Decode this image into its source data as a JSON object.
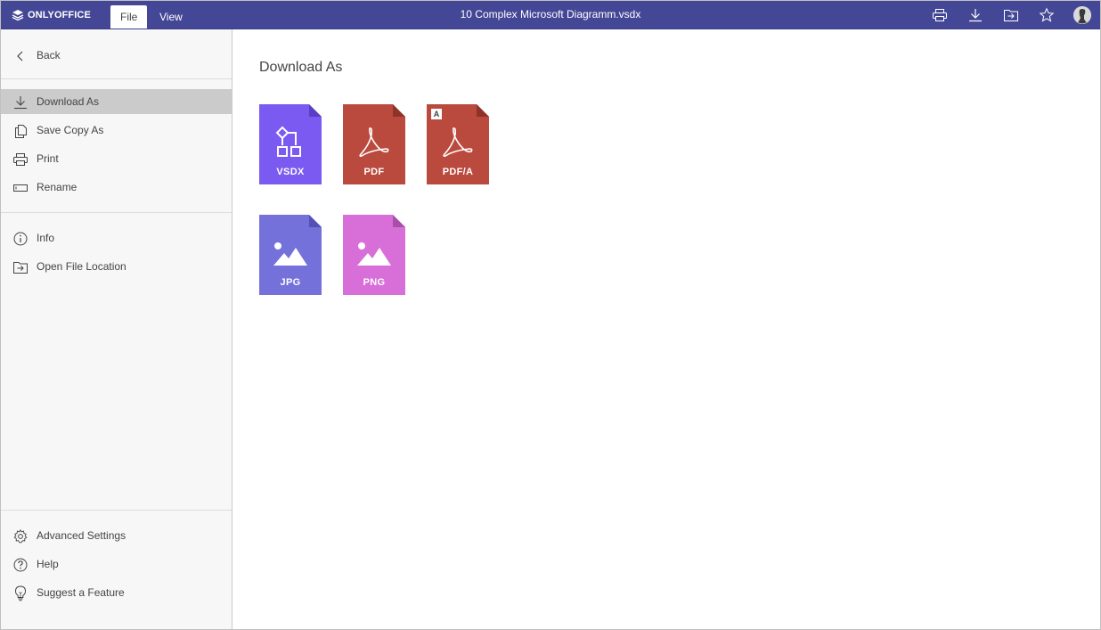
{
  "topbar": {
    "logo_text": "ONLYOFFICE",
    "tabs": [
      {
        "label": "File",
        "active": true
      },
      {
        "label": "View",
        "active": false
      }
    ],
    "document_title": "10 Complex Microsoft Diagramm.vsdx",
    "icons": [
      "print-icon",
      "download-icon",
      "open-location-icon",
      "favorite-star-icon",
      "user-avatar"
    ]
  },
  "sidebar": {
    "back_label": "Back",
    "group1": [
      {
        "label": "Download As",
        "icon": "download-icon",
        "active": true
      },
      {
        "label": "Save Copy As",
        "icon": "copy-icon",
        "active": false
      },
      {
        "label": "Print",
        "icon": "print-icon",
        "active": false
      },
      {
        "label": "Rename",
        "icon": "rename-icon",
        "active": false
      }
    ],
    "group2": [
      {
        "label": "Info",
        "icon": "info-icon"
      },
      {
        "label": "Open File Location",
        "icon": "folder-open-icon"
      }
    ],
    "group3": [
      {
        "label": "Advanced Settings",
        "icon": "gear-icon"
      },
      {
        "label": "Help",
        "icon": "help-icon"
      },
      {
        "label": "Suggest a Feature",
        "icon": "lightbulb-icon"
      }
    ]
  },
  "main": {
    "heading": "Download As",
    "formats": [
      {
        "label": "VSDX",
        "color": "#7a5af0",
        "icon": "diagram-icon"
      },
      {
        "label": "PDF",
        "color": "#bb4a3e",
        "icon": "acrobat-icon"
      },
      {
        "label": "PDF/A",
        "color": "#bb4a3e",
        "icon": "acrobat-icon",
        "badge": "A"
      },
      {
        "label": "JPG",
        "color": "#7471db",
        "icon": "image-icon"
      },
      {
        "label": "PNG",
        "color": "#d86ed8",
        "icon": "image-icon"
      }
    ]
  },
  "colors": {
    "topbar": "#444796",
    "sidebar_bg": "#f7f7f7",
    "active_item": "#cbcbcb"
  }
}
